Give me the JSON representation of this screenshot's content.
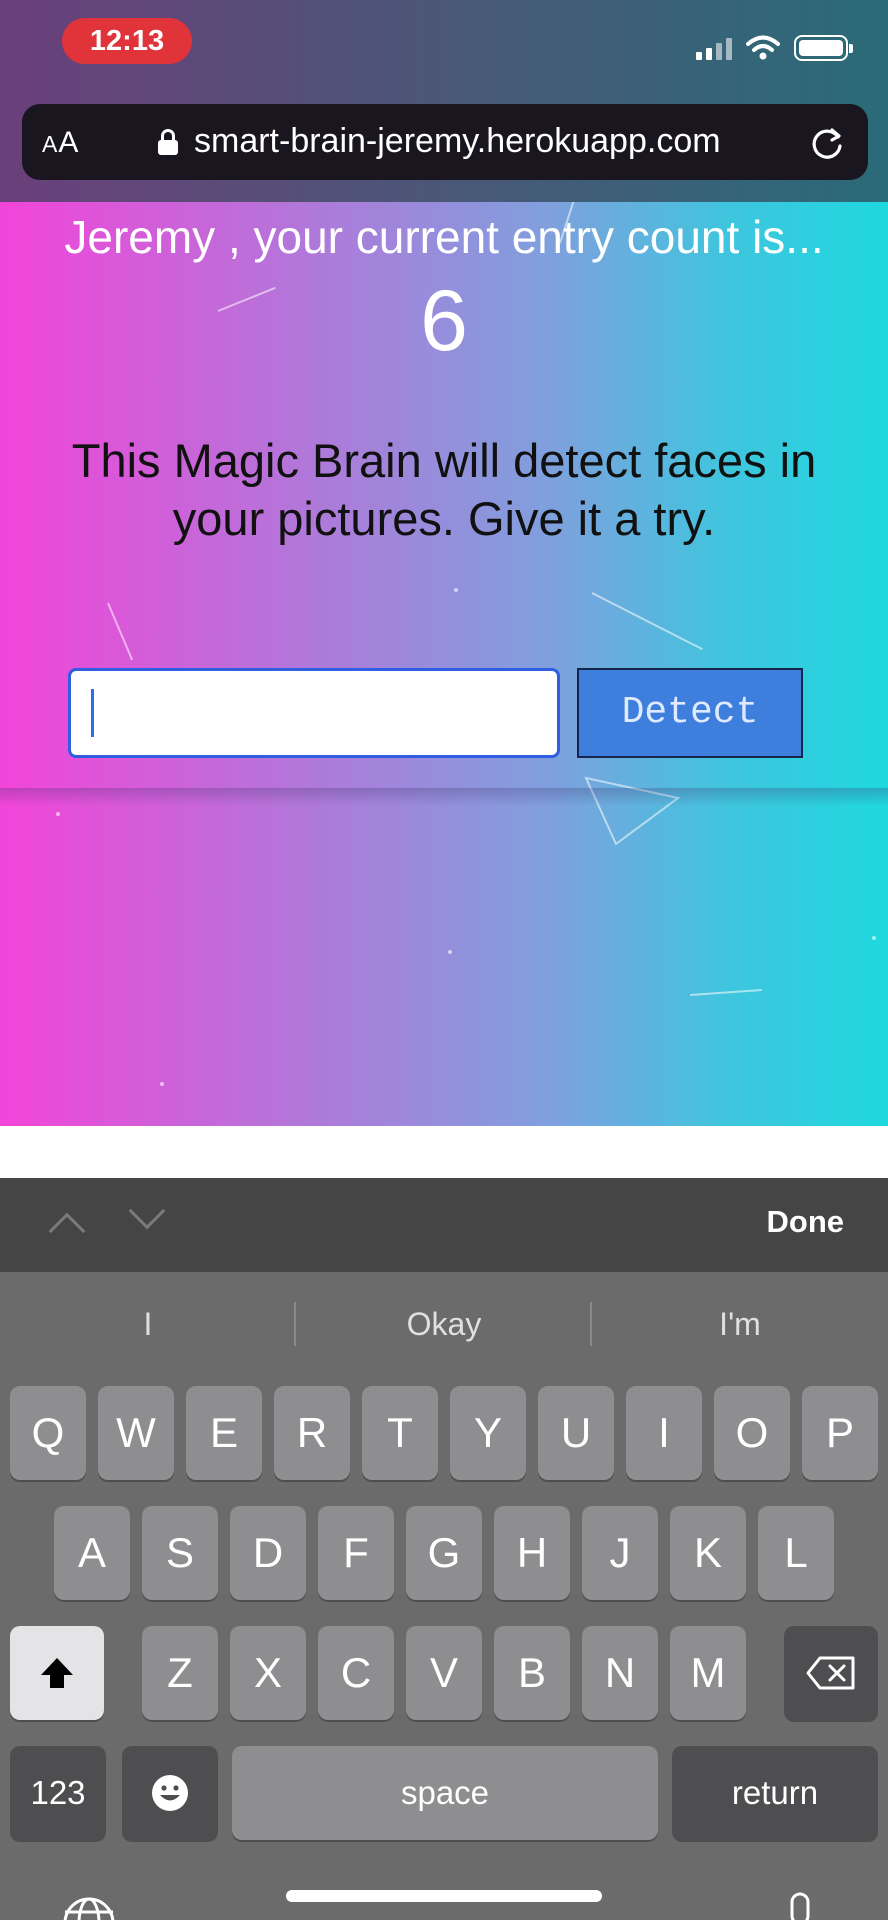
{
  "status_bar": {
    "time": "12:13"
  },
  "browser": {
    "text_size_button": "AA",
    "url": "smart-brain-jeremy.herokuapp.com"
  },
  "page": {
    "entry_message": "Jeremy , your current entry count is...",
    "entry_count": "6",
    "description": "This Magic Brain will detect faces in your pictures. Give it a try.",
    "image_url_input": {
      "value": "",
      "placeholder": ""
    },
    "detect_button": "Detect"
  },
  "keyboard": {
    "done_label": "Done",
    "suggestions": [
      "I",
      "Okay",
      "I'm"
    ],
    "row1": [
      "Q",
      "W",
      "E",
      "R",
      "T",
      "Y",
      "U",
      "I",
      "O",
      "P"
    ],
    "row2": [
      "A",
      "S",
      "D",
      "F",
      "G",
      "H",
      "J",
      "K",
      "L"
    ],
    "row3": [
      "Z",
      "X",
      "C",
      "V",
      "B",
      "N",
      "M"
    ],
    "numbers_key": "123",
    "space_key": "space",
    "return_key": "return"
  }
}
